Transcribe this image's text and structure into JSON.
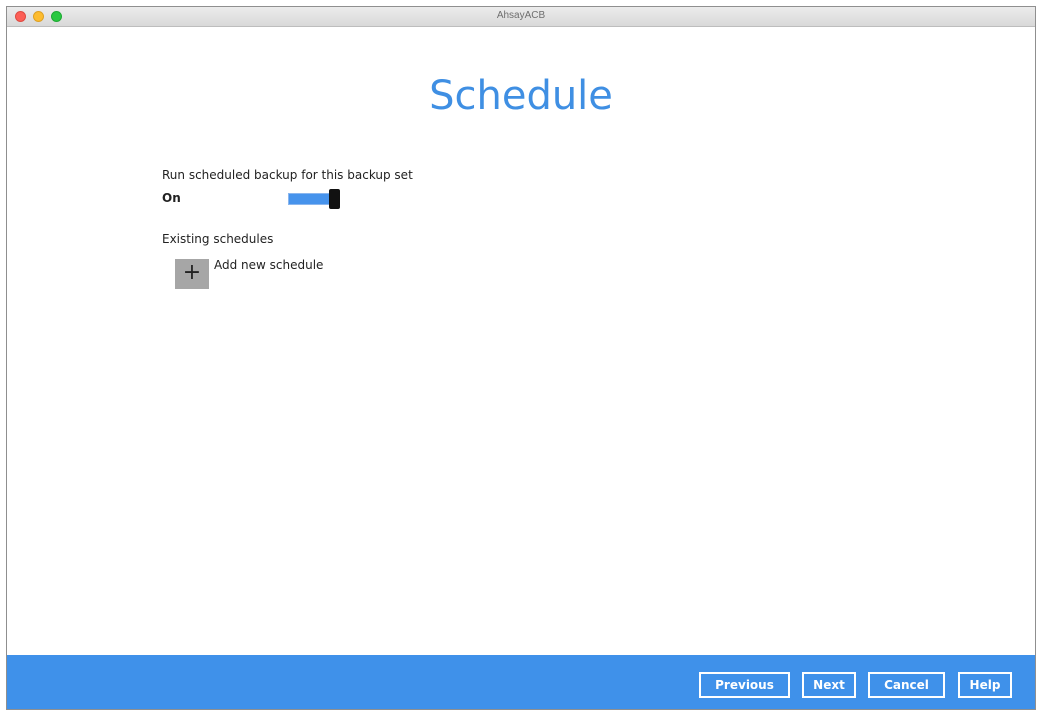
{
  "window": {
    "title": "AhsayACB"
  },
  "page": {
    "title": "Schedule"
  },
  "schedule": {
    "run_label": "Run scheduled backup for this backup set",
    "state_label": "On",
    "toggle_on": true,
    "existing_label": "Existing schedules",
    "add_label": "Add new schedule",
    "add_icon": "+"
  },
  "footer": {
    "previous": "Previous",
    "next": "Next",
    "cancel": "Cancel",
    "help": "Help"
  },
  "colors": {
    "accent": "#3f91ea",
    "title": "#3f8fe3",
    "toggle_track": "#4693ec"
  }
}
